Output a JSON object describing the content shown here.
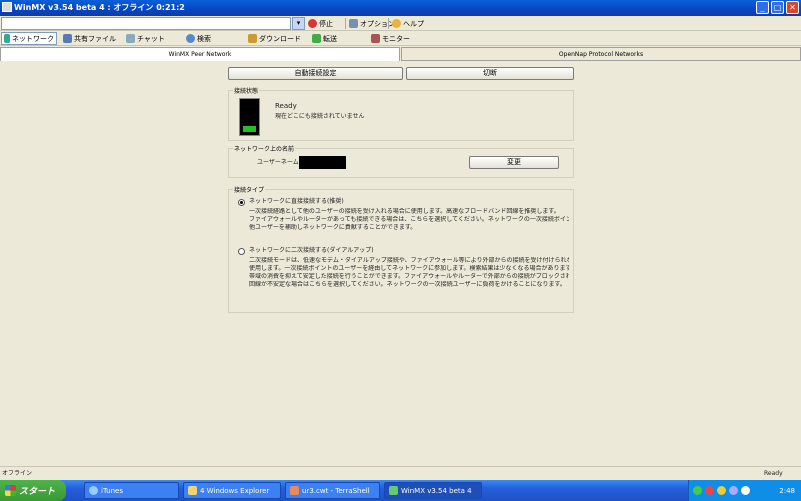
{
  "window": {
    "title": "WinMX v3.54 beta 4 : オフライン 0:21:2",
    "minimize_glyph": "_",
    "maximize_glyph": "□",
    "close_glyph": "✕"
  },
  "toolbar": {
    "search_value": "",
    "combo_glyph": "▾",
    "stop_label": "停止",
    "options_label": "オプション",
    "help_label": "ヘルプ"
  },
  "nav": {
    "tabs": [
      {
        "label": "ネットワーク"
      },
      {
        "label": "共有ファイル"
      },
      {
        "label": "チャット"
      },
      {
        "label": "検索"
      },
      {
        "label": "ダウンロード"
      },
      {
        "label": "転送"
      },
      {
        "label": "モニター"
      }
    ]
  },
  "network_tabs": {
    "left": "WinMX Peer Network",
    "right": "OpenNap Protocol Networks"
  },
  "actions": {
    "settings_button": "自動接続設定",
    "disconnect_button": "切断"
  },
  "status_group": {
    "title": "接続状態",
    "heading": "Ready",
    "message": "現在どこにも接続されていません",
    "level": 0.2
  },
  "network_group": {
    "title": "ネットワーク上の名前",
    "username_label": "ユーザーネーム",
    "username_value": "",
    "change_button": "変更"
  },
  "mode_group": {
    "title": "接続タイプ",
    "option1_label": "ネットワークに直接接続する(推奨)",
    "option1_desc": [
      "一次接続経路として他のユーザーの接続を受け入れる場合に使用します。高速なブロードバンド回線を推奨します。",
      "ファイアウォールやルーターがあっても接続できる場合は、こちらを選択してください。ネットワークの一次接続ポイントとして",
      "他ユーザーを補助しネットワークに貢献することができます。"
    ],
    "option2_label": "ネットワークに二次接続する(ダイアルアップ)",
    "option2_desc": [
      "二次接続モードは、低速なモデム・ダイアルアップ接続や、ファイアウォール等により外部からの接続を受け付けられない場合に",
      "使用します。一次接続ポイントのユーザーを経由してネットワークに参加します。検索結果は少なくなる場合がありますが、",
      "帯域の消費を抑えて安定した接続を行うことができます。ファイアウォールやルーターで外部からの接続がブロックされている場合や、",
      "回線が不安定な場合はこちらを選択してください。ネットワークの一次接続ユーザーに負荷をかけることになります。"
    ]
  },
  "statusbar": {
    "left": "オフライン",
    "right": "Ready"
  },
  "taskbar": {
    "start_label": "スタート",
    "tasks": [
      {
        "label": "iTunes"
      },
      {
        "label": "4 Windows Explorer"
      },
      {
        "label": "ur3.cwt - TerraShell"
      },
      {
        "label": "WinMX v3.54 beta 4"
      }
    ],
    "clock": "2:48"
  }
}
